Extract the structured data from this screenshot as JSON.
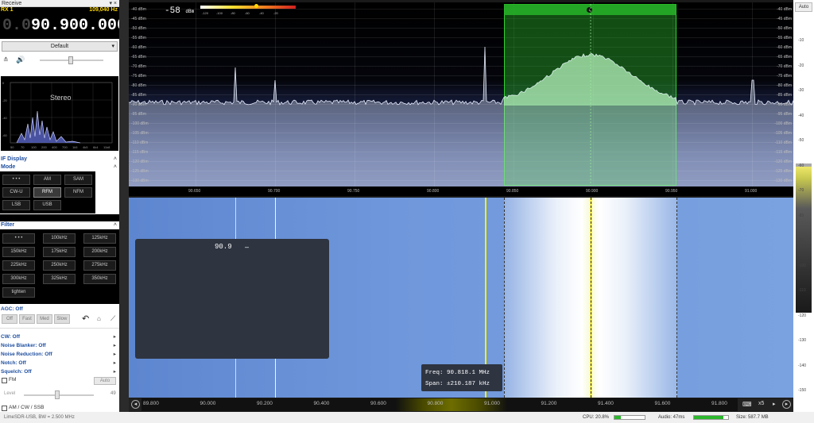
{
  "left_panel": {
    "receive_title": "Receive",
    "rx_label": "RX 1",
    "rx_freq_small": "109,040 Hz",
    "main_freq_dim": "0.0",
    "main_freq": "90.900.000",
    "preset": "Default",
    "stereo_label": "Stereo",
    "audio_y_ticks": [
      "0",
      "-20",
      "-40",
      "-60",
      "-80"
    ],
    "audio_x_ticks": [
      "50",
      "70",
      "100",
      "200",
      "400",
      "700",
      "1k5",
      "4k5",
      "6k4",
      "11k8"
    ],
    "if_display_label": "IF Display",
    "mode_label": "Mode",
    "mode_buttons": [
      "• • •",
      "AM",
      "SAM",
      "CW-U",
      "RFM",
      "NFM",
      "LSB",
      "USB"
    ],
    "filter_label": "Filter",
    "filter_buttons": [
      "• • •",
      "100kHz",
      "125kHz",
      "150kHz",
      "175kHz",
      "200kHz",
      "225kHz",
      "250kHz",
      "275kHz",
      "300kHz",
      "325kHz",
      "350kHz",
      "tighten"
    ],
    "agc_label": "AGC: Off",
    "agc_buttons": [
      "Off",
      "Fast",
      "Med",
      "Slow"
    ],
    "options": [
      "CW: Off",
      "Noise Blanker: Off",
      "Noise Reduction: Off",
      "Notch: Off",
      "Squelch: Off"
    ],
    "fm_label": "FM",
    "auto_label": "Auto",
    "level_label": "Level",
    "level_value": "49",
    "am_cw_ssb_label": "AM / CW / SSB"
  },
  "spectrum": {
    "signal_level": "-58",
    "signal_unit": "dBm",
    "meter_ticks": [
      "-120",
      "-100",
      "-80",
      "-60",
      "-40",
      "-20"
    ],
    "db_labels": [
      "-40 dBm",
      "-45 dBm",
      "-50 dBm",
      "-55 dBm",
      "-60 dBm",
      "-65 dBm",
      "-70 dBm",
      "-75 dBm",
      "-80 dBm",
      "-85 dBm",
      "-90 dBm",
      "-95 dBm",
      "-100 dBm",
      "-105 dBm",
      "-110 dBm",
      "-115 dBm",
      "-120 dBm",
      "-125 dBm",
      "-130 dBm"
    ],
    "freq_ticks": [
      "90.650",
      "90.700",
      "90.750",
      "90.800",
      "90.850",
      "90.900",
      "90.950",
      "91.000"
    ],
    "vfo_marker": "1"
  },
  "waterfall": {
    "overlay_text": "90.9",
    "overlay_dash": "–",
    "tooltip_freq": "Freq: 90.818.1 MHz",
    "tooltip_span": "Span: ±210.187 kHz"
  },
  "bottom_axis": {
    "ticks": [
      "89.800",
      "90.000",
      "90.200",
      "90.400",
      "90.600",
      "90.800",
      "91.000",
      "91.200",
      "91.400",
      "91.600",
      "91.800"
    ],
    "zoom": "x5"
  },
  "right_bar": {
    "auto_label": "Auto",
    "ticks": [
      "-10",
      "-20",
      "-30",
      "-40",
      "-50",
      "-60",
      "-70",
      "-80",
      "-90",
      "-100",
      "-110",
      "-120",
      "-130",
      "-140",
      "-150"
    ]
  },
  "status": {
    "device_info": "LimeSDR-USB, BW = 2.500 MHz",
    "cpu": "CPU: 20.8%",
    "audio": "Audio: 47ms",
    "size": "Size: 587.7 MB"
  },
  "colors": {
    "accent_blue": "#1f4fa0",
    "filter_green": "#1fa01f",
    "rx_yellow": "#ffd800"
  }
}
